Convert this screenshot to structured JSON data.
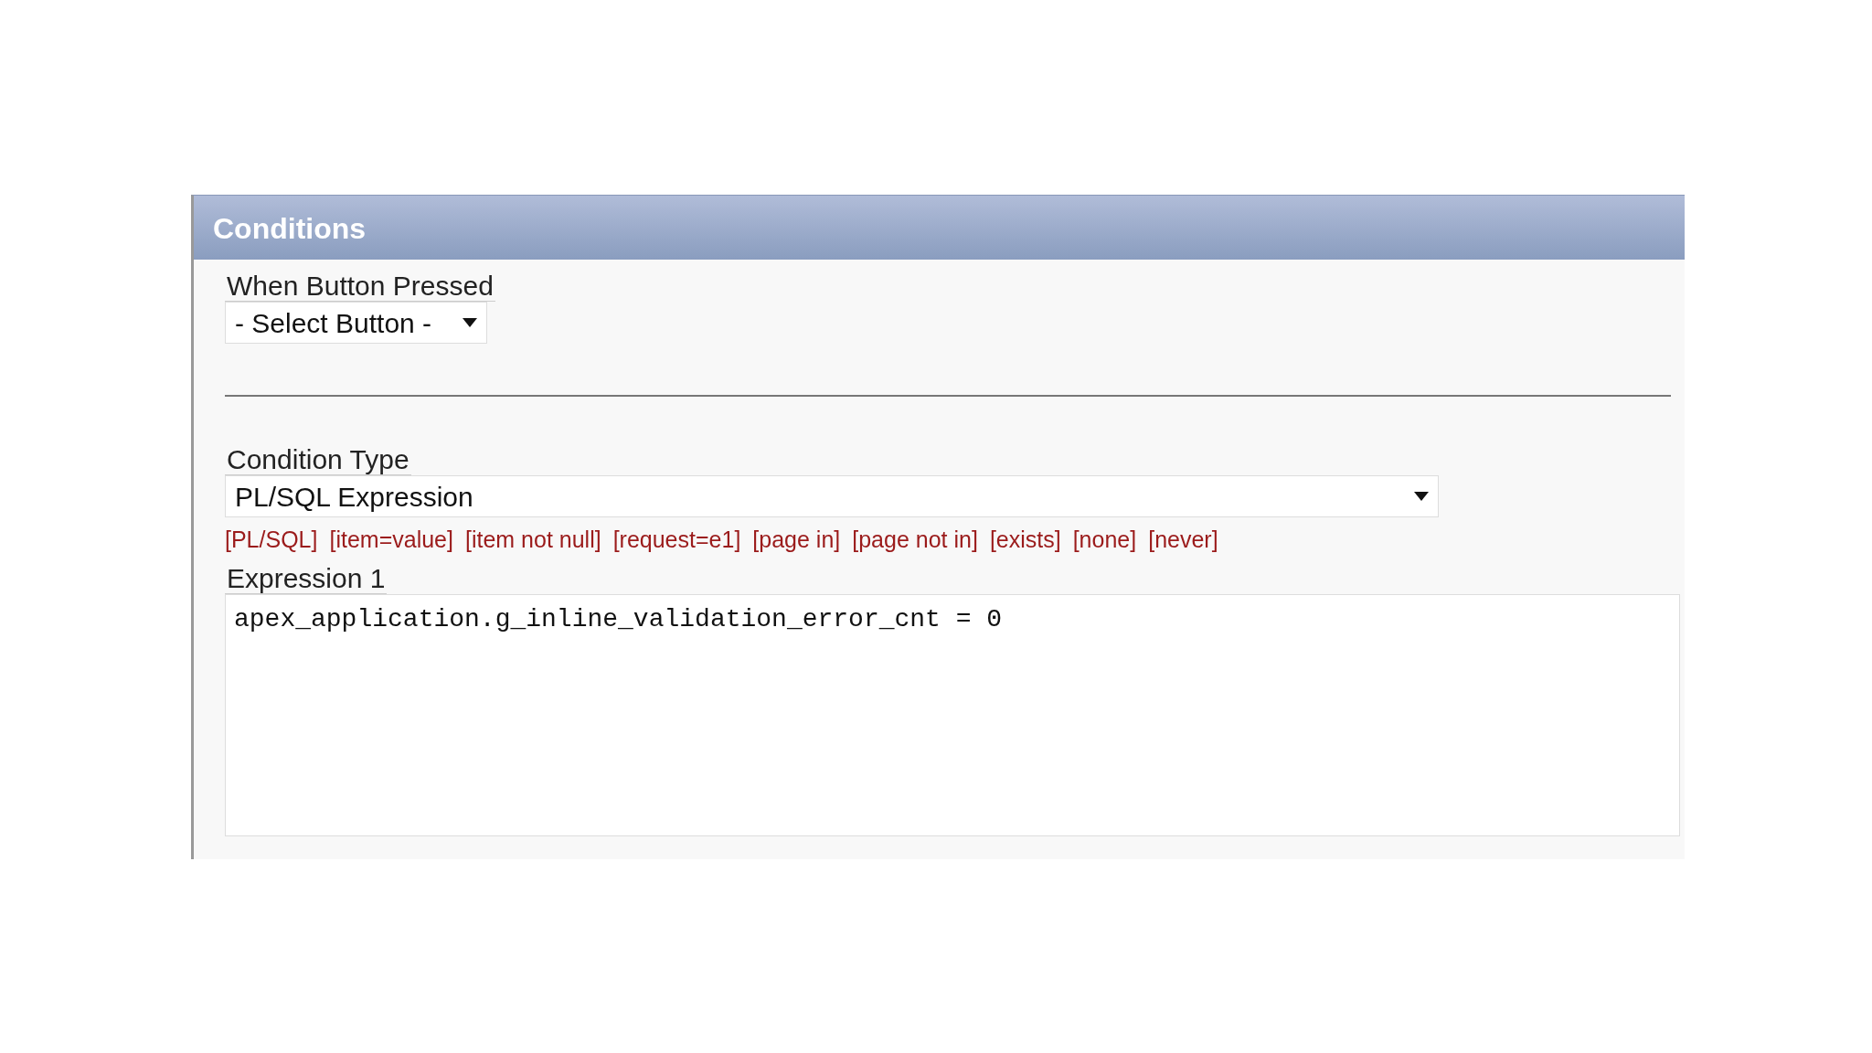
{
  "panel": {
    "title": "Conditions"
  },
  "button_field": {
    "label": "When Button Pressed",
    "value": "- Select Button -"
  },
  "condition_type": {
    "label": "Condition Type",
    "value": "PL/SQL Expression"
  },
  "shortcuts": [
    "[PL/SQL]",
    "[item=value]",
    "[item not null]",
    "[request=e1]",
    "[page in]",
    "[page not in]",
    "[exists]",
    "[none]",
    "[never]"
  ],
  "expression": {
    "label": "Expression 1",
    "value": "apex_application.g_inline_validation_error_cnt = 0"
  }
}
